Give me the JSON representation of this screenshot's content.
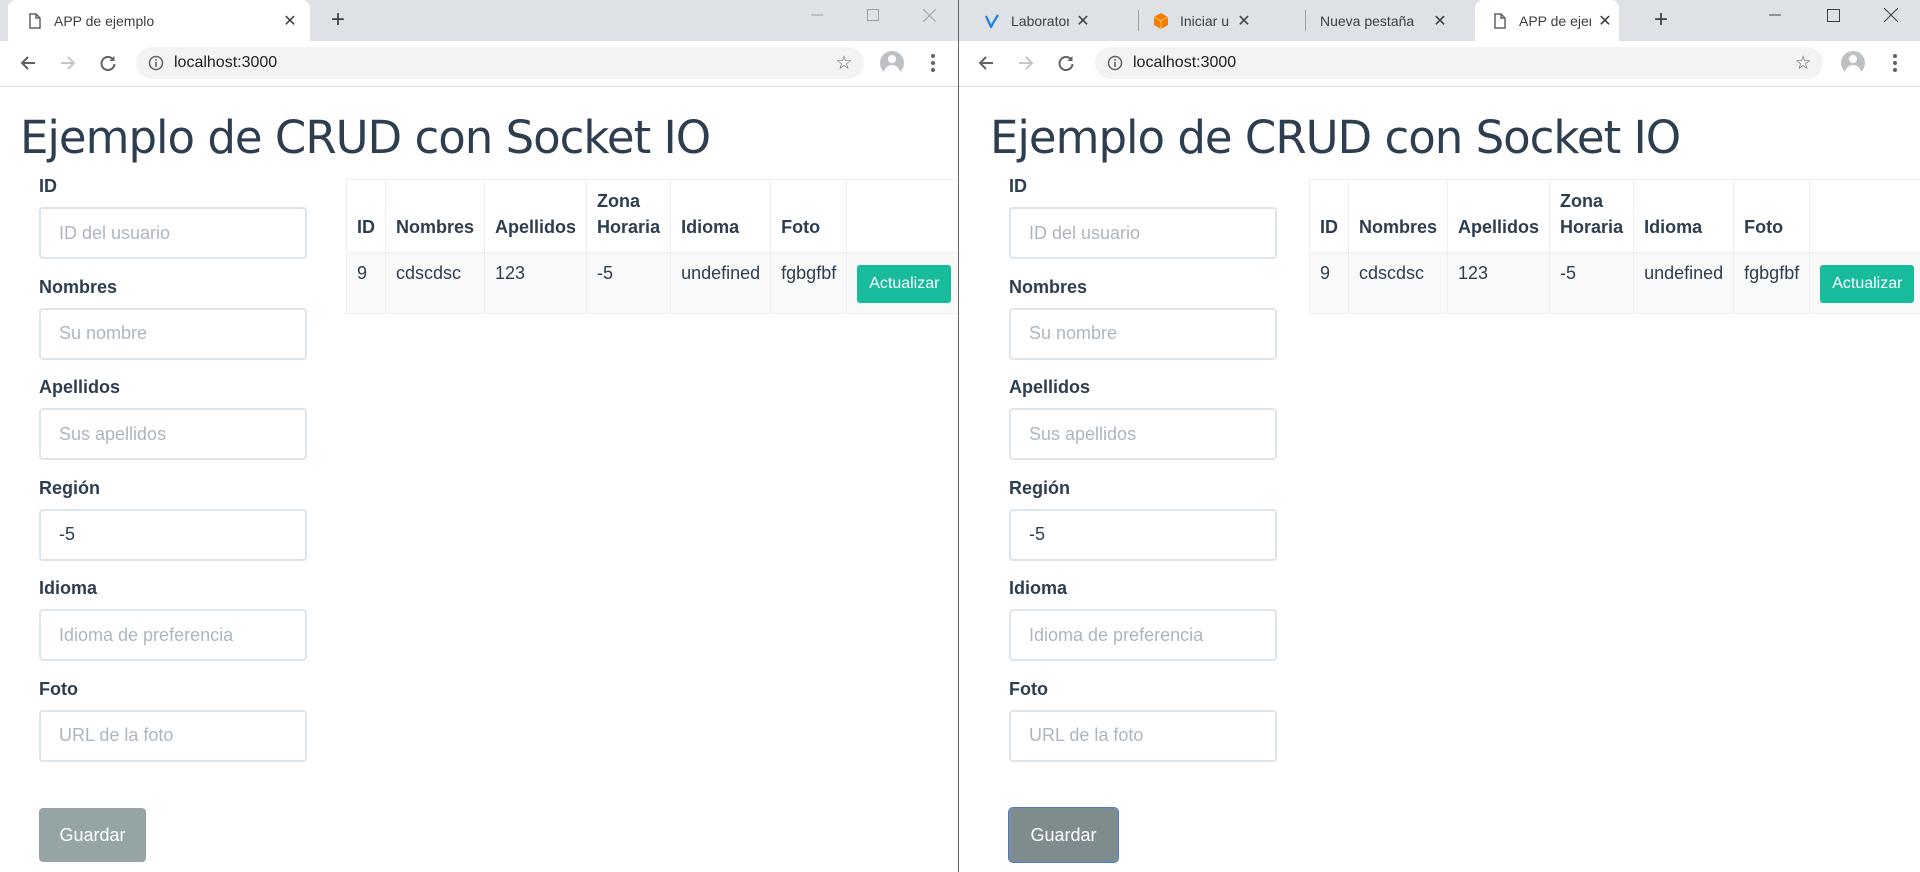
{
  "left_window": {
    "tabs": [
      {
        "title": "APP de ejemplo",
        "icon": "document-icon",
        "active": true
      }
    ],
    "url": "localhost:3000",
    "page": {
      "title": "Ejemplo de CRUD con Socket IO",
      "form": {
        "fields": [
          {
            "label": "ID",
            "placeholder": "ID del usuario",
            "value": ""
          },
          {
            "label": "Nombres",
            "placeholder": "Su nombre",
            "value": ""
          },
          {
            "label": "Apellidos",
            "placeholder": "Sus apellidos",
            "value": ""
          },
          {
            "label": "Región",
            "placeholder": "",
            "value": "-5"
          },
          {
            "label": "Idioma",
            "placeholder": "Idioma de preferencia",
            "value": ""
          },
          {
            "label": "Foto",
            "placeholder": "URL de la foto",
            "value": ""
          }
        ],
        "save_label": "Guardar"
      },
      "table": {
        "headers": [
          "ID",
          "Nombres",
          "Apellidos",
          "Zona Horaria",
          "Idioma",
          "Foto"
        ],
        "rows": [
          {
            "id": "9",
            "nombres": "cdscdsc",
            "apellidos": "123",
            "zona": "-5",
            "idioma": "undefined",
            "foto": "fgbgfbf",
            "action_label": "Actualizar"
          }
        ]
      }
    }
  },
  "right_window": {
    "tabs": [
      {
        "title": "Laboratorio-C",
        "icon": "v-logo-icon",
        "active": false
      },
      {
        "title": "Iniciar una m",
        "icon": "cube-icon",
        "active": false
      },
      {
        "title": "Nueva pestaña",
        "icon": "",
        "active": false
      },
      {
        "title": "APP de ejemp",
        "icon": "document-icon",
        "active": true
      }
    ],
    "url": "localhost:3000",
    "page": {
      "title": "Ejemplo de CRUD con Socket IO",
      "form": {
        "fields": [
          {
            "label": "ID",
            "placeholder": "ID del usuario",
            "value": ""
          },
          {
            "label": "Nombres",
            "placeholder": "Su nombre",
            "value": ""
          },
          {
            "label": "Apellidos",
            "placeholder": "Sus apellidos",
            "value": ""
          },
          {
            "label": "Región",
            "placeholder": "",
            "value": "-5"
          },
          {
            "label": "Idioma",
            "placeholder": "Idioma de preferencia",
            "value": ""
          },
          {
            "label": "Foto",
            "placeholder": "URL de la foto",
            "value": ""
          }
        ],
        "save_label": "Guardar"
      },
      "table": {
        "headers": [
          "ID",
          "Nombres",
          "Apellidos",
          "Zona Horaria",
          "Idioma",
          "Foto"
        ],
        "rows": [
          {
            "id": "9",
            "nombres": "cdscdsc",
            "apellidos": "123",
            "zona": "-5",
            "idioma": "undefined",
            "foto": "fgbgfbf",
            "action_label": "Actualizar"
          }
        ]
      }
    }
  },
  "colors": {
    "heading": "#2c3e50",
    "input_border": "#dce4ec",
    "placeholder": "#acb6c0",
    "save_button": "#95a5a6",
    "save_button_focused": "#7f8c8d",
    "update_button": "#18bc9c",
    "tabstrip": "#dee1e6"
  },
  "icons": [
    "back-icon",
    "forward-icon",
    "reload-icon",
    "info-icon",
    "star-icon",
    "profile-icon",
    "menu-icon",
    "close-icon",
    "new-tab-icon",
    "minimize-icon",
    "maximize-icon",
    "window-close-icon"
  ]
}
